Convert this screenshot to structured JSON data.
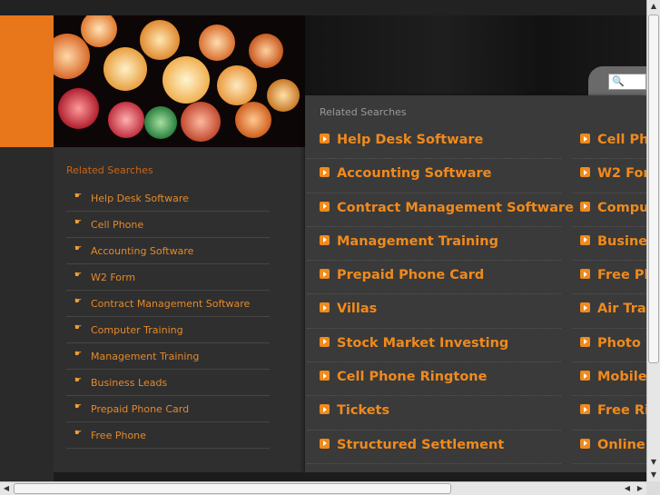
{
  "search": {
    "placeholder": ""
  },
  "sidebar": {
    "title": "Related Searches",
    "items": [
      "Help Desk Software",
      "Cell Phone",
      "Accounting Software",
      "W2 Form",
      "Contract Management Software",
      "Computer Training",
      "Management Training",
      "Business Leads",
      "Prepaid Phone Card",
      "Free Phone"
    ]
  },
  "main": {
    "title": "Related Searches",
    "col1": [
      "Help Desk Software",
      "Accounting Software",
      "Contract Management Software",
      "Management Training",
      "Prepaid Phone Card",
      "Villas",
      "Stock Market Investing",
      "Cell Phone Ringtone",
      "Tickets",
      "Structured Settlement"
    ],
    "col2": [
      "Cell Ph",
      "W2 For",
      "Compu",
      "Busine",
      "Free Ph",
      "Air Trav",
      "Photo E",
      "Mobile",
      "Free Ri",
      "Online"
    ]
  },
  "colors": {
    "accent": "#f08a1c",
    "brand_orange": "#e8761a",
    "background": "#2a2a2a"
  }
}
